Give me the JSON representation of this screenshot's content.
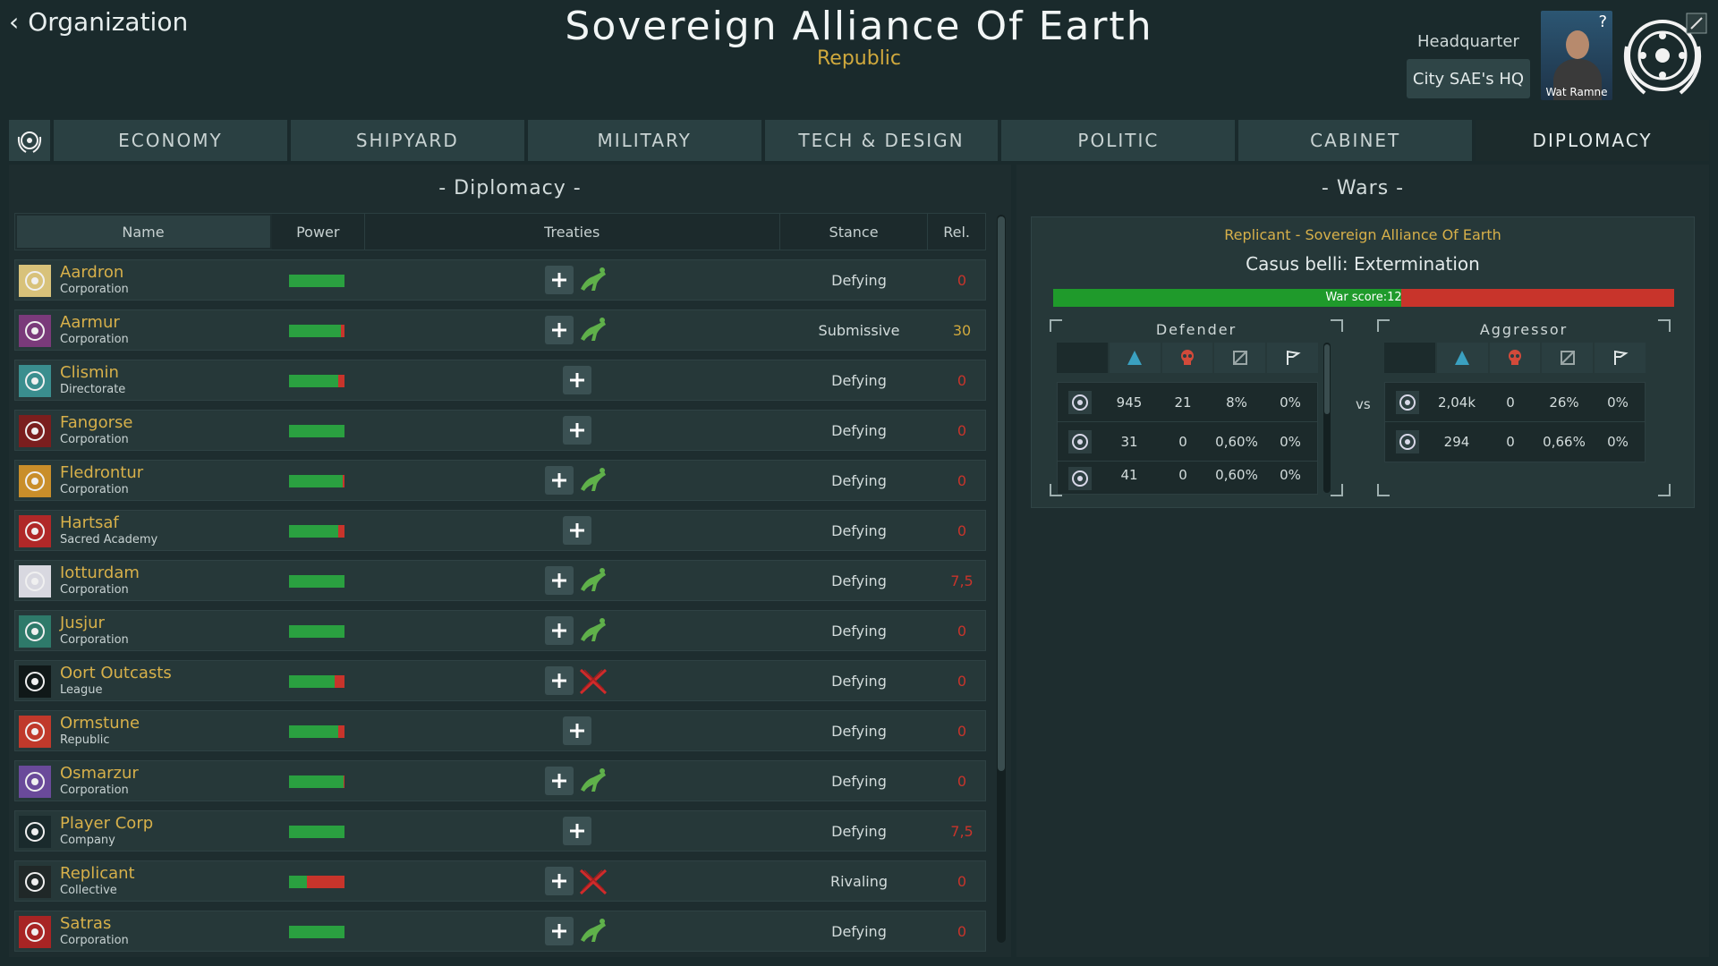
{
  "header": {
    "back_label": "Organization",
    "title": "Sovereign Alliance Of Earth",
    "subtitle": "Republic",
    "hq_label": "Headquarter",
    "hq_value": "City SAE's HQ",
    "leader_name": "Wat Ramne",
    "help_glyph": "?"
  },
  "tabs": [
    {
      "label": "ECONOMY",
      "active": false
    },
    {
      "label": "SHIPYARD",
      "active": false
    },
    {
      "label": "MILITARY",
      "active": false
    },
    {
      "label": "TECH & DESIGN",
      "active": false
    },
    {
      "label": "POLITIC",
      "active": false
    },
    {
      "label": "CABINET",
      "active": false
    },
    {
      "label": "DIPLOMACY",
      "active": true
    }
  ],
  "diplomacy": {
    "title": "- Diplomacy -",
    "columns": {
      "name": "Name",
      "power": "Power",
      "treaties": "Treaties",
      "stance": "Stance",
      "rel": "Rel."
    },
    "rows": [
      {
        "name": "Aardron",
        "type": "Corporation",
        "power": 1.0,
        "treaty": "peace",
        "stance": "Defying",
        "rel": "0",
        "rel_color": "#c8342b",
        "icon_color": "#d8c27a"
      },
      {
        "name": "Aarmur",
        "type": "Corporation",
        "power": 0.94,
        "treaty": "peace",
        "stance": "Submissive",
        "rel": "30",
        "rel_color": "#d0a93d",
        "icon_color": "#7a3a7a"
      },
      {
        "name": "Clismin",
        "type": "Directorate",
        "power": 0.88,
        "treaty": "none",
        "stance": "Defying",
        "rel": "0",
        "rel_color": "#c8342b",
        "icon_color": "#3a8e8e"
      },
      {
        "name": "Fangorse",
        "type": "Corporation",
        "power": 1.0,
        "treaty": "none",
        "stance": "Defying",
        "rel": "0",
        "rel_color": "#c8342b",
        "icon_color": "#7a1e1e"
      },
      {
        "name": "Fledrontur",
        "type": "Corporation",
        "power": 0.97,
        "treaty": "peace",
        "stance": "Defying",
        "rel": "0",
        "rel_color": "#c8342b",
        "icon_color": "#c98e2a"
      },
      {
        "name": "Hartsaf",
        "type": "Sacred Academy",
        "power": 0.88,
        "treaty": "none",
        "stance": "Defying",
        "rel": "0",
        "rel_color": "#c8342b",
        "icon_color": "#b02828"
      },
      {
        "name": "Iotturdam",
        "type": "Corporation",
        "power": 1.0,
        "treaty": "peace",
        "stance": "Defying",
        "rel": "7,5",
        "rel_color": "#c8342b",
        "icon_color": "#d8d8e0"
      },
      {
        "name": "Jusjur",
        "type": "Corporation",
        "power": 1.0,
        "treaty": "peace",
        "stance": "Defying",
        "rel": "0",
        "rel_color": "#c8342b",
        "icon_color": "#2e7a6a"
      },
      {
        "name": "Oort Outcasts",
        "type": "League",
        "power": 0.82,
        "treaty": "war",
        "stance": "Defying",
        "rel": "0",
        "rel_color": "#c8342b",
        "icon_color": "#101818"
      },
      {
        "name": "Ormstune",
        "type": "Republic",
        "power": 0.88,
        "treaty": "none",
        "stance": "Defying",
        "rel": "0",
        "rel_color": "#c8342b",
        "icon_color": "#c0392b"
      },
      {
        "name": "Osmarzur",
        "type": "Corporation",
        "power": 0.98,
        "treaty": "peace",
        "stance": "Defying",
        "rel": "0",
        "rel_color": "#c8342b",
        "icon_color": "#6a4a9a"
      },
      {
        "name": "Player Corp",
        "type": "Company",
        "power": 1.0,
        "treaty": "none",
        "stance": "Defying",
        "rel": "7,5",
        "rel_color": "#c8342b",
        "icon_color": "#1a2a2c"
      },
      {
        "name": "Replicant",
        "type": "Collective",
        "power": 0.32,
        "treaty": "war",
        "stance": "Rivaling",
        "rel": "0",
        "rel_color": "#c8342b",
        "icon_color": "#202828"
      },
      {
        "name": "Satras",
        "type": "Corporation",
        "power": 1.0,
        "treaty": "peace",
        "stance": "Defying",
        "rel": "0",
        "rel_color": "#c8342b",
        "icon_color": "#a82424"
      }
    ]
  },
  "wars": {
    "title": "- Wars -",
    "sides": "Replicant - Sovereign Alliance Of Earth",
    "casus": "Casus belli: Extermination",
    "score_label": "War score:12",
    "score_fraction": 0.56,
    "vs": "vs",
    "defender": {
      "title": "Defender",
      "rows": [
        {
          "emblem": "sae",
          "ships": "945",
          "losses": "21",
          "occupied": "8%",
          "captured": "0%"
        },
        {
          "emblem": "osmarzur",
          "ships": "31",
          "losses": "0",
          "occupied": "0,60%",
          "captured": "0%"
        },
        {
          "emblem": "fledrontur",
          "ships": "41",
          "losses": "0",
          "occupied": "0,60%",
          "captured": "0%"
        }
      ]
    },
    "aggressor": {
      "title": "Aggressor",
      "rows": [
        {
          "emblem": "replicant",
          "ships": "2,04k",
          "losses": "0",
          "occupied": "26%",
          "captured": "0%"
        },
        {
          "emblem": "oort",
          "ships": "294",
          "losses": "0",
          "occupied": "0,66%",
          "captured": "0%"
        }
      ]
    }
  }
}
